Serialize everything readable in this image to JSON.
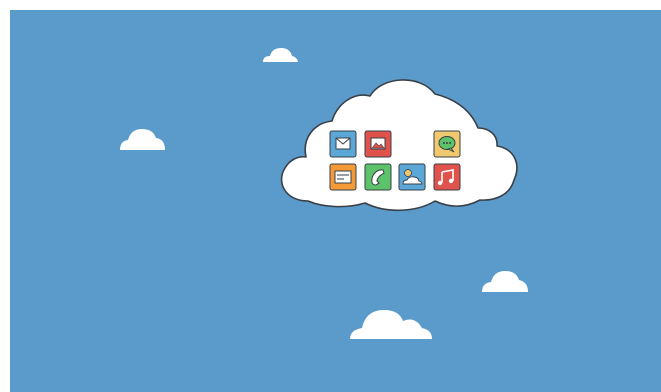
{
  "colors": {
    "sky": "#5a9bcb",
    "cloud": "#ffffff",
    "outline": "#3a3f46",
    "mail_tile": "#5aa7d8",
    "photo_tile": "#e0524c",
    "chat_tile": "#f2c86e",
    "card_tile": "#f49a37",
    "phone_tile": "#5cc36b",
    "weather_tile": "#5aa7d8",
    "music_tile": "#e0524c"
  },
  "background_clouds": [
    "small-cloud",
    "small-cloud",
    "small-cloud",
    "small-cloud"
  ],
  "main_cloud": {
    "apps": [
      {
        "name": "mail-app",
        "icon": "mail-icon"
      },
      {
        "name": "photo-app",
        "icon": "image-icon"
      },
      {
        "name": "chat-app",
        "icon": "chat-bubble-icon"
      },
      {
        "name": "card-app",
        "icon": "card-icon"
      },
      {
        "name": "phone-app",
        "icon": "phone-icon"
      },
      {
        "name": "weather-app",
        "icon": "weather-icon"
      },
      {
        "name": "music-app",
        "icon": "music-note-icon"
      }
    ]
  }
}
